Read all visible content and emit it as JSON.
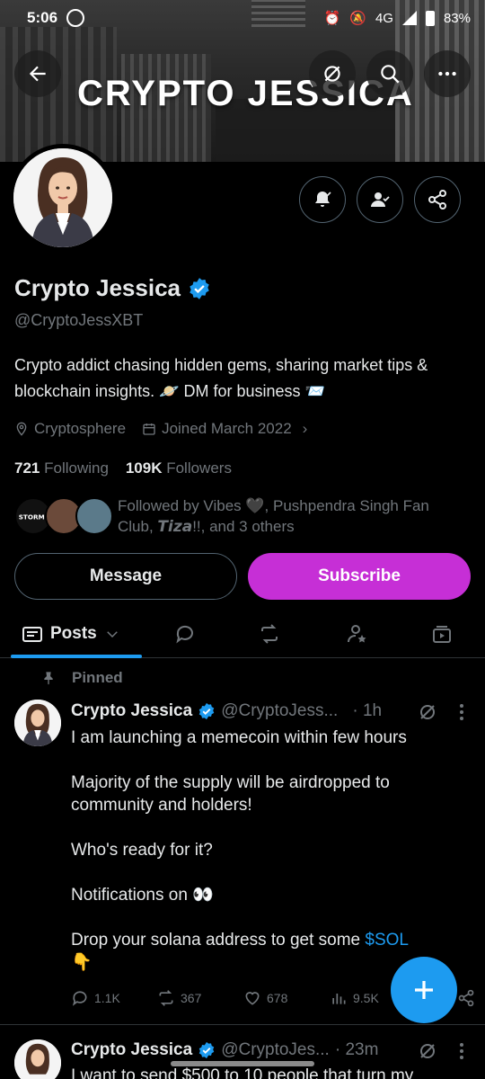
{
  "status_bar": {
    "time": "5:06",
    "network": "4G",
    "battery": "83%"
  },
  "banner": {
    "title": "CRYPTO JESSICA"
  },
  "profile": {
    "name": "Crypto Jessica",
    "handle": "@CryptoJessXBT",
    "bio": "Crypto addict chasing hidden gems, sharing market tips & blockchain insights. 🪐  DM for business 📨",
    "location": "Cryptosphere",
    "joined": "Joined March 2022",
    "following_count": "721",
    "following_label": "Following",
    "followers_count": "109K",
    "followers_label": "Followers",
    "followed_by": "Followed by Vibes 🖤, Pushpendra Singh Fan Club, 𝙏𝙞𝙯𝙖!!, and 3 others"
  },
  "buttons": {
    "message": "Message",
    "subscribe": "Subscribe"
  },
  "tabs": {
    "posts": "Posts"
  },
  "pinned_label": "Pinned",
  "post1": {
    "name": "Crypto Jessica",
    "handle": "@CryptoJess...",
    "time": "· 1h",
    "line1": "I am launching a memecoin within few hours",
    "line2": "Majority of the supply will be airdropped to community and holders!",
    "line3": "Who's ready for it?",
    "line4": "Notifications on 👀",
    "line5_pre": "Drop your solana address to get some ",
    "line5_link": "$SOL",
    "line5_post": "👇",
    "replies": "1.1K",
    "reposts": "367",
    "likes": "678",
    "views": "9.5K"
  },
  "post2": {
    "name": "Crypto Jessica",
    "handle": "@CryptoJes...",
    "time": "· 23m",
    "text": "I want to send $500 to 10 people that turn my"
  },
  "colors": {
    "accent": "#1d9bf0",
    "subscribe": "#c62fd6",
    "muted": "#71767b"
  }
}
